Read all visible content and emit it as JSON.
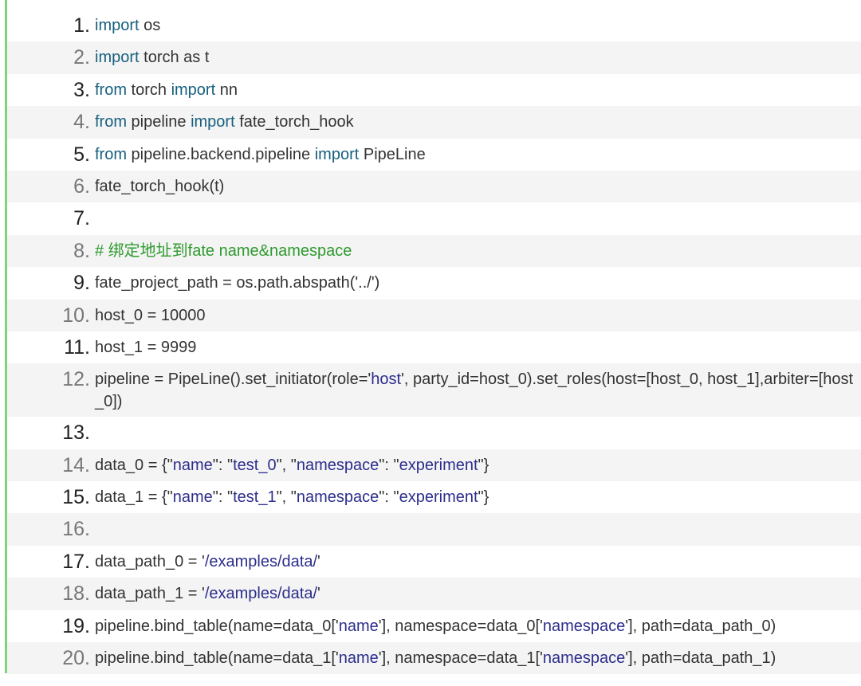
{
  "code": {
    "lines": [
      {
        "n": "1.",
        "tokens": [
          [
            "kw",
            "import"
          ],
          [
            "t",
            " os"
          ]
        ]
      },
      {
        "n": "2.",
        "tokens": [
          [
            "kw",
            "import"
          ],
          [
            "t",
            " torch as t"
          ]
        ]
      },
      {
        "n": "3.",
        "tokens": [
          [
            "kw",
            "from"
          ],
          [
            "t",
            " torch "
          ],
          [
            "kw",
            "import"
          ],
          [
            "t",
            " nn"
          ]
        ]
      },
      {
        "n": "4.",
        "tokens": [
          [
            "kw",
            "from"
          ],
          [
            "t",
            " pipeline "
          ],
          [
            "kw",
            "import"
          ],
          [
            "t",
            " fate_torch_hook"
          ]
        ]
      },
      {
        "n": "5.",
        "tokens": [
          [
            "kw",
            "from"
          ],
          [
            "t",
            " pipeline.backend.pipeline "
          ],
          [
            "kw",
            "import"
          ],
          [
            "t",
            " PipeLine"
          ]
        ]
      },
      {
        "n": "6.",
        "tokens": [
          [
            "t",
            "fate_torch_hook(t)"
          ]
        ]
      },
      {
        "n": "7.",
        "tokens": []
      },
      {
        "n": "8.",
        "tokens": [
          [
            "cm",
            "# 绑定地址到fate name&namespace"
          ]
        ]
      },
      {
        "n": "9.",
        "tokens": [
          [
            "t",
            "fate_project_path = os.path.abspath('../')"
          ]
        ]
      },
      {
        "n": "10.",
        "tokens": [
          [
            "t",
            "host_0 = 10000"
          ]
        ]
      },
      {
        "n": "11.",
        "tokens": [
          [
            "t",
            "host_1 = 9999"
          ]
        ]
      },
      {
        "n": "12.",
        "tokens": [
          [
            "t",
            "pipeline = PipeLine().set_initiator(role='"
          ],
          [
            "str",
            "host"
          ],
          [
            "t",
            "', party_id=host_0).set_roles(host=[host_0, host_1],arbiter=[host_0])"
          ]
        ]
      },
      {
        "n": "13.",
        "tokens": []
      },
      {
        "n": "14.",
        "tokens": [
          [
            "t",
            "data_0 = {\""
          ],
          [
            "str",
            "name"
          ],
          [
            "t",
            "\": \""
          ],
          [
            "str",
            "test_0"
          ],
          [
            "t",
            "\", \""
          ],
          [
            "str",
            "namespace"
          ],
          [
            "t",
            "\": \""
          ],
          [
            "str",
            "experiment"
          ],
          [
            "t",
            "\"}"
          ]
        ]
      },
      {
        "n": "15.",
        "tokens": [
          [
            "t",
            "data_1 = {\""
          ],
          [
            "str",
            "name"
          ],
          [
            "t",
            "\": \""
          ],
          [
            "str",
            "test_1"
          ],
          [
            "t",
            "\", \""
          ],
          [
            "str",
            "namespace"
          ],
          [
            "t",
            "\": \""
          ],
          [
            "str",
            "experiment"
          ],
          [
            "t",
            "\"}"
          ]
        ]
      },
      {
        "n": "16.",
        "tokens": []
      },
      {
        "n": "17.",
        "tokens": [
          [
            "t",
            "data_path_0 = '"
          ],
          [
            "str",
            "/examples/data/"
          ],
          [
            "t",
            "'"
          ]
        ]
      },
      {
        "n": "18.",
        "tokens": [
          [
            "t",
            "data_path_1 = '"
          ],
          [
            "str",
            "/examples/data/"
          ],
          [
            "t",
            "'"
          ]
        ]
      },
      {
        "n": "19.",
        "tokens": [
          [
            "t",
            "pipeline.bind_table(name=data_0['"
          ],
          [
            "str",
            "name"
          ],
          [
            "t",
            "'], namespace=data_0['"
          ],
          [
            "str",
            "namespace"
          ],
          [
            "t",
            "'], path=data_path_0)"
          ]
        ]
      },
      {
        "n": "20.",
        "tokens": [
          [
            "t",
            "pipeline.bind_table(name=data_1['"
          ],
          [
            "str",
            "name"
          ],
          [
            "t",
            "'], namespace=data_1['"
          ],
          [
            "str",
            "namespace"
          ],
          [
            "t",
            "'], path=data_path_1)"
          ]
        ]
      }
    ]
  },
  "colors": {
    "keyword": "#17607e",
    "comment": "#2e9a2e",
    "string": "#2c2e8c",
    "accent_border": "#7ed47e"
  }
}
